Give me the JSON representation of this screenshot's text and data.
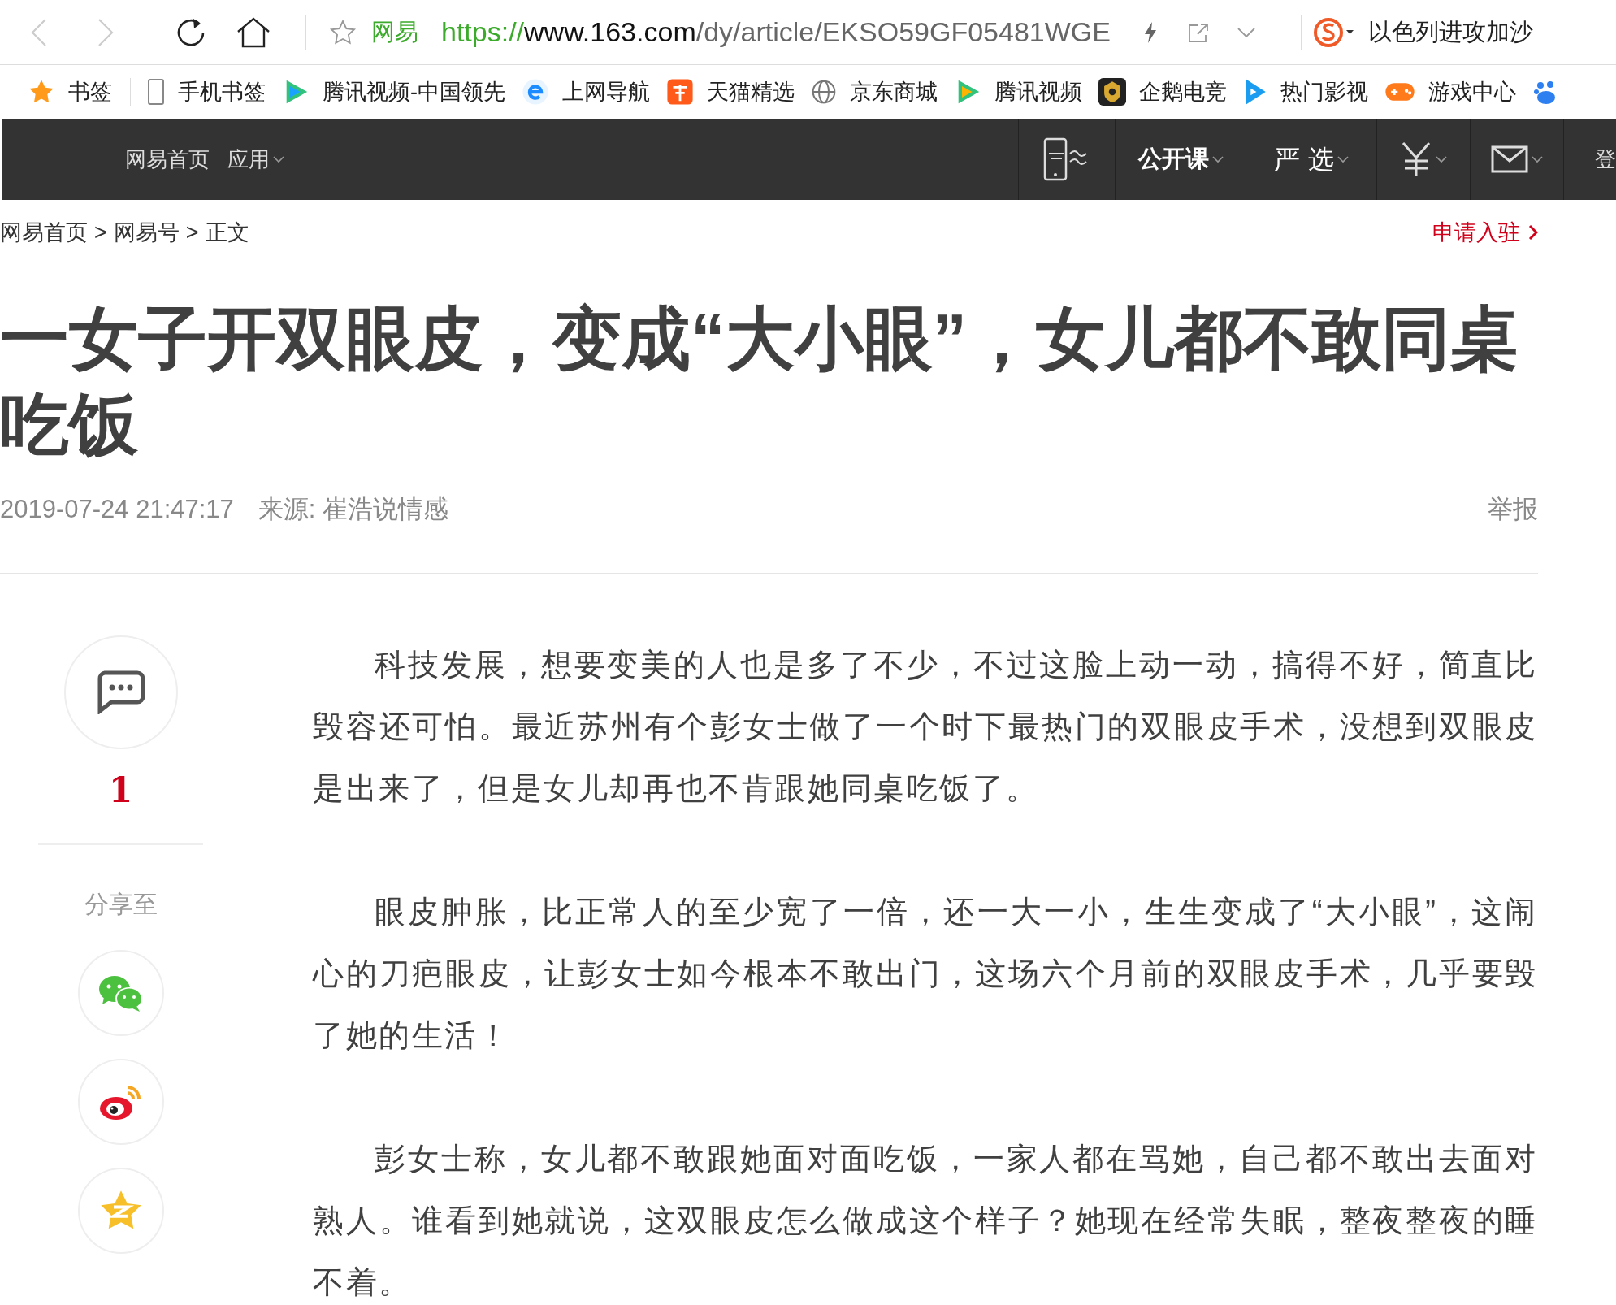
{
  "browser": {
    "site_label": "网易",
    "url_scheme": "https://",
    "url_host": "www.163.com",
    "url_path": "/dy/article/EKSO59GF05481WGE",
    "search_text": "以色列进攻加沙",
    "bookmarks": [
      "书签",
      "手机书签",
      "腾讯视频-中国领先",
      "上网导航",
      "天猫精选",
      "京东商城",
      "腾讯视频",
      "企鹅电竞",
      "热门影视",
      "游戏中心"
    ]
  },
  "site_nav": {
    "left": [
      {
        "label": "网易首页",
        "dropdown": false
      },
      {
        "label": "应用",
        "dropdown": true
      }
    ],
    "right": [
      {
        "label": "公开课"
      },
      {
        "label": "严 选"
      }
    ],
    "login": "登"
  },
  "breadcrumb": {
    "items": [
      "网易首页",
      "网易号",
      "正文"
    ],
    "separator": ">"
  },
  "apply_link": "申请入驻",
  "article": {
    "title": "一女子开双眼皮，变成“大小眼”，女儿都不敢同桌吃饭",
    "time": "2019-07-24 21:47:17",
    "source": "来源: 崔浩说情感",
    "report": "举报",
    "paragraphs": [
      "科技发展，想要变美的人也是多了不少，不过这脸上动一动，搞得不好，简直比毁容还可怕。最近苏州有个彭女士做了一个时下最热门的双眼皮手术，没想到双眼皮是出来了，但是女儿却再也不肯跟她同桌吃饭了。",
      "眼皮肿胀，比正常人的至少宽了一倍，还一大一小，生生变成了“大小眼”，这闹心的刀疤眼皮，让彭女士如今根本不敢出门，这场六个月前的双眼皮手术，几乎要毁了她的生活！",
      "彭女士称，女儿都不敢跟她面对面吃饭，一家人都在骂她，自己都不敢出去面对熟人。谁看到她就说，这双眼皮怎么做成这个样子？她现在经常失眠，整夜整夜的睡不着。"
    ]
  },
  "sidebar": {
    "comment_count": "1",
    "share_label": "分享至"
  }
}
